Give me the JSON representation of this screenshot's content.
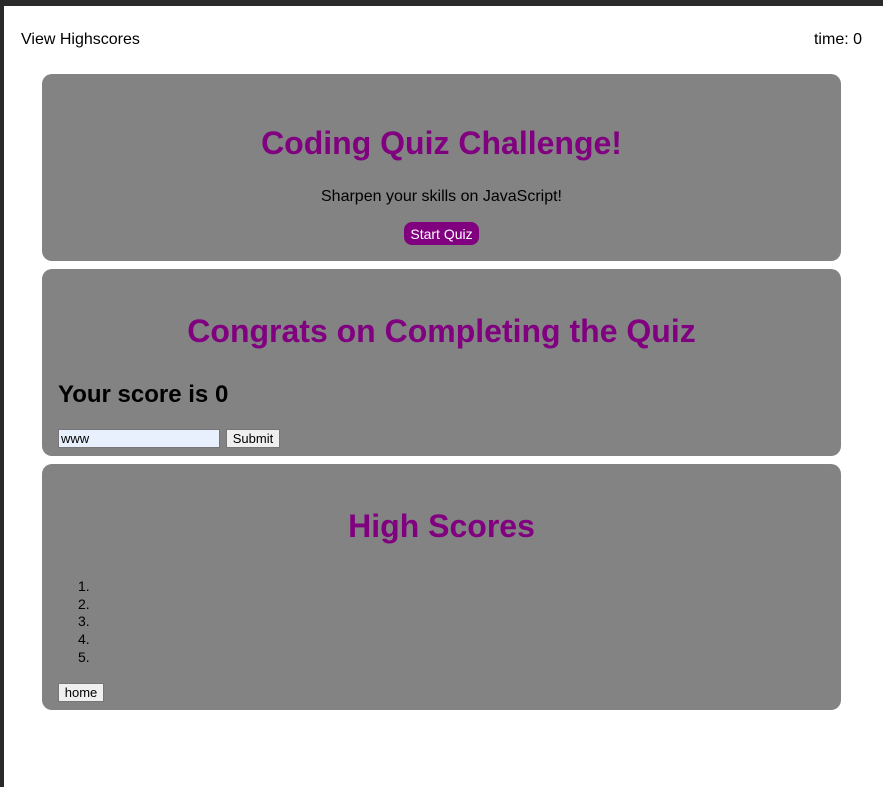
{
  "header": {
    "highscores_link": "View Highscores",
    "time_label": "time: 0"
  },
  "start_card": {
    "title": "Coding Quiz Challenge!",
    "subtitle": "Sharpen your skills on JavaScript!",
    "start_button": "Start Quiz"
  },
  "end_card": {
    "title": "Congrats on Completing the Quiz",
    "score_text": "Your score is 0",
    "initials_value": "www",
    "submit_button": "Submit"
  },
  "scores_card": {
    "title": "High Scores",
    "entries": [
      "1.",
      "2.",
      "3.",
      "4.",
      "5."
    ],
    "home_button": "home"
  },
  "colors": {
    "accent": "#800080",
    "card_background": "#838383"
  }
}
